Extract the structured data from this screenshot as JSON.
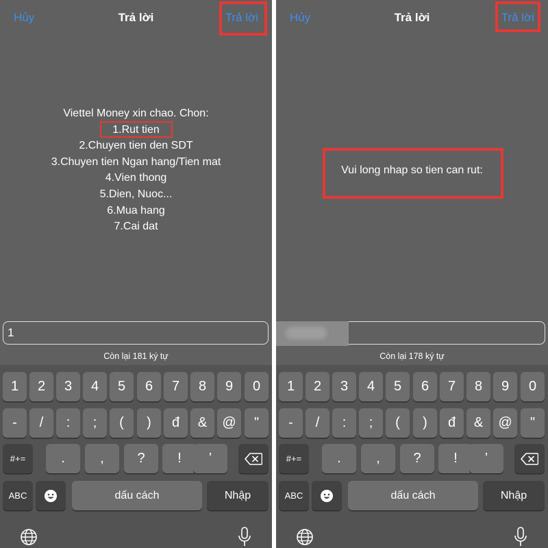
{
  "screens": [
    {
      "nav": {
        "cancel": "Hủy",
        "title": "Trả lời",
        "reply": "Trả lời"
      },
      "message": {
        "greeting": "Viettel Money xin chao. Chon:",
        "options": [
          "1.Rut tien",
          "2.Chuyen tien den SDT",
          "3.Chuyen tien Ngan hang/Tien mat",
          "4.Vien thong",
          "5.Dien, Nuoc...",
          "6.Mua hang",
          "7.Cai dat"
        ]
      },
      "input": {
        "value": "1"
      },
      "counter": "Còn lại 181 ký tự"
    },
    {
      "nav": {
        "cancel": "Hủy",
        "title": "Trả lời",
        "reply": "Trả lời"
      },
      "message": {
        "prompt": "Vui long nhap so tien can rut:"
      },
      "input": {
        "value": ""
      },
      "counter": "Còn lại 178 ký tự"
    }
  ],
  "keyboard": {
    "row1": [
      "1",
      "2",
      "3",
      "4",
      "5",
      "6",
      "7",
      "8",
      "9",
      "0"
    ],
    "row2": [
      "-",
      "/",
      ":",
      ";",
      "(",
      ")",
      "đ",
      "&",
      "@",
      "\""
    ],
    "row3": [
      ".",
      ",",
      "?",
      "!",
      "’"
    ],
    "mode_key": "#+=",
    "abc_key": "ABC",
    "space_key": "dấu cách",
    "return_key": "Nhập"
  },
  "colors": {
    "accent": "#3f8ee8",
    "highlight": "#e53935",
    "background": "#606060",
    "keyboard": "#535353"
  },
  "icons": [
    "backspace-icon",
    "emoji-icon",
    "globe-icon",
    "microphone-icon"
  ]
}
